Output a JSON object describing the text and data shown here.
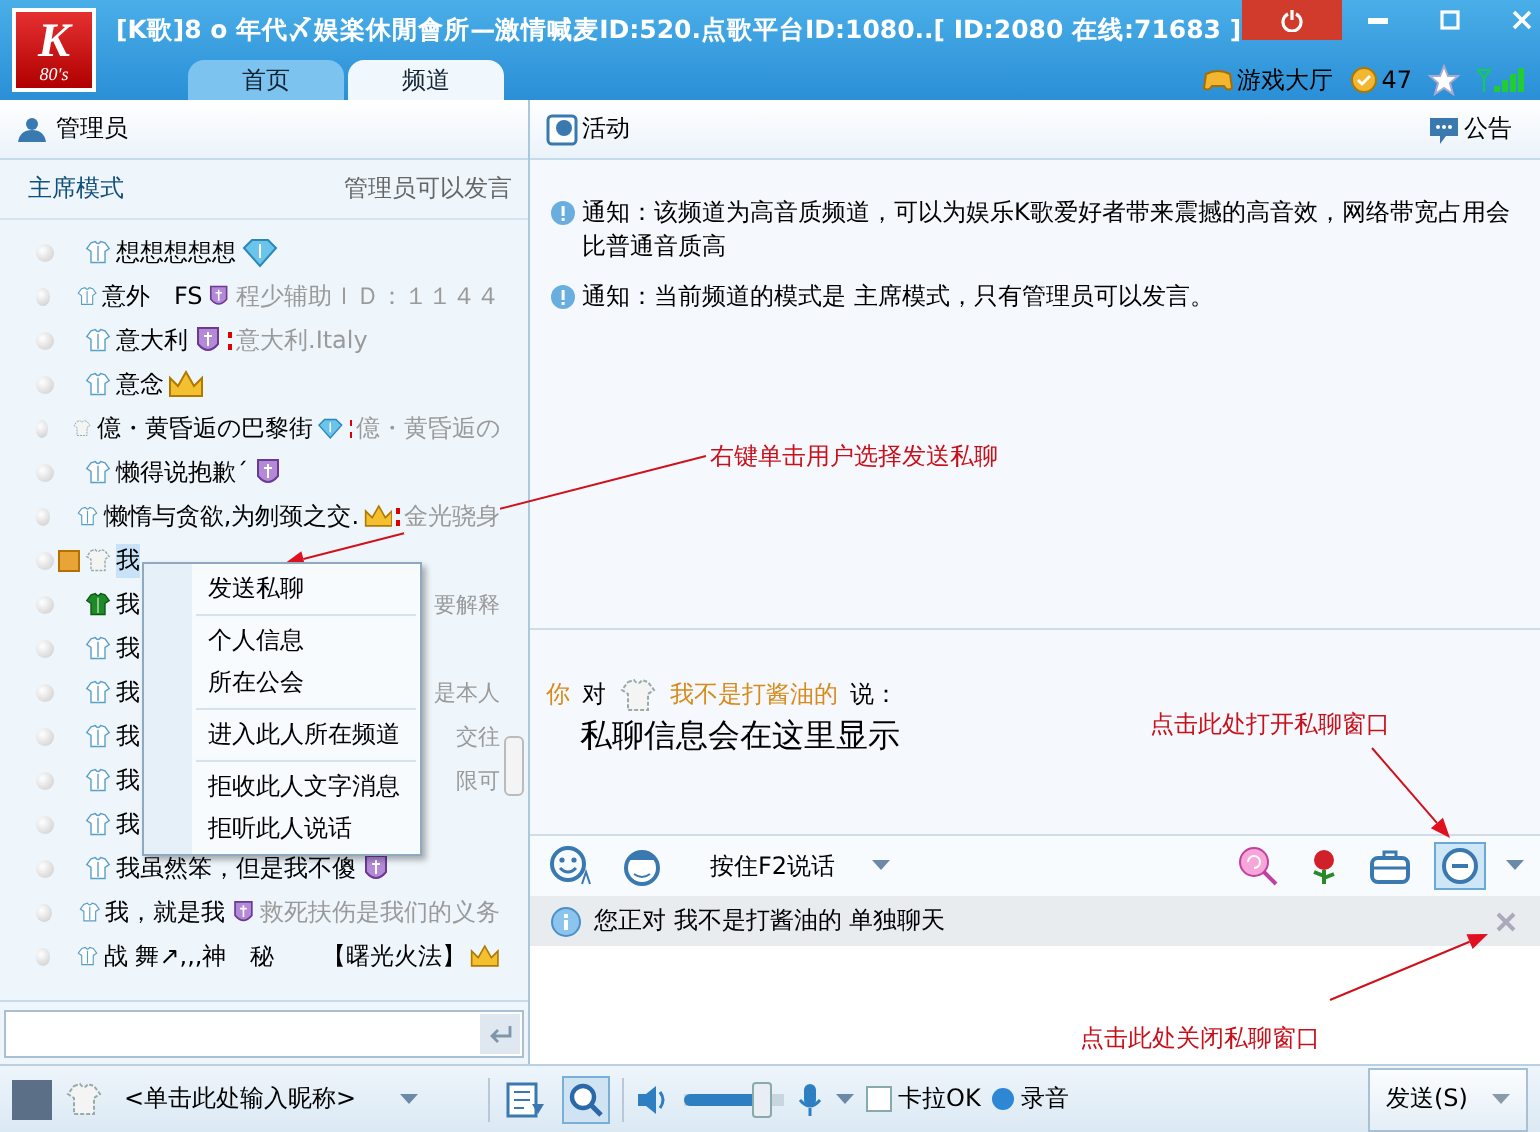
{
  "window": {
    "logo": "K",
    "logo_sub": "80's",
    "title": "[K歌]8 o 年代〆娱楽休閒會所—激情喊麦ID:520.点歌平台ID:1080..[ ID:2080 在线:71683 ]"
  },
  "tabs": [
    {
      "label": "首页",
      "selected": false
    },
    {
      "label": "频道",
      "selected": true
    }
  ],
  "top_right": {
    "game_hall": "游戏大厅",
    "coins": "47"
  },
  "left_panel": {
    "title": "管理员",
    "mode": "主席模式",
    "mode_note": "管理员可以发言",
    "users": [
      {
        "kind": "diamond",
        "name": "想想想想想",
        "guest": false,
        "admin": false,
        "flagged": false,
        "vip": false,
        "selected": false
      },
      {
        "kind": "shield",
        "name": "意外　FS",
        "guest": false,
        "admin": false,
        "flagged": false,
        "sign": "程少辅助ＩＤ：１１４４",
        "vip": false,
        "selected": false
      },
      {
        "kind": "shield",
        "name": "意大利",
        "guest": false,
        "admin": false,
        "flagged": true,
        "sign": "意大利.Italy",
        "vip": false,
        "selected": false
      },
      {
        "kind": "crown",
        "name": "意念",
        "guest": false,
        "admin": false,
        "flagged": false,
        "vip": false,
        "selected": false
      },
      {
        "kind": "diamond",
        "name": "億・黄昏逅の巴黎街",
        "guest": true,
        "admin": false,
        "flagged": true,
        "sign": "億・黄昏逅の",
        "vip": false,
        "selected": false
      },
      {
        "kind": "shield",
        "name": "懒得说抱歉ˊ",
        "guest": false,
        "admin": false,
        "flagged": false,
        "vip": false,
        "selected": false
      },
      {
        "kind": "crown",
        "name": "懒惰与贪欲,为刎颈之交.",
        "guest": false,
        "admin": false,
        "flagged": true,
        "sign": "金光骁身",
        "vip": false,
        "selected": false
      },
      {
        "kind": "plain",
        "name": "我",
        "guest": true,
        "admin": false,
        "flagged": false,
        "vip": true,
        "selected": true
      },
      {
        "kind": "plain",
        "name": "我",
        "guest": false,
        "admin": true,
        "flagged": false,
        "sign": "要解释",
        "vip": false,
        "selected": false
      },
      {
        "kind": "plain",
        "name": "我",
        "guest": false,
        "admin": false,
        "flagged": false,
        "vip": false,
        "selected": false
      },
      {
        "kind": "plain",
        "name": "我",
        "guest": false,
        "admin": false,
        "flagged": false,
        "sign": "是本人",
        "vip": false,
        "selected": false
      },
      {
        "kind": "plain",
        "name": "我",
        "guest": false,
        "admin": false,
        "flagged": false,
        "sign": "交往",
        "vip": false,
        "selected": false
      },
      {
        "kind": "plain",
        "name": "我",
        "guest": false,
        "admin": false,
        "flagged": false,
        "sign": "限可",
        "vip": false,
        "selected": false
      },
      {
        "kind": "plain",
        "name": "我",
        "guest": false,
        "admin": false,
        "flagged": false,
        "vip": false,
        "selected": false
      },
      {
        "kind": "shield",
        "name": "我虽然笨，但是我不傻",
        "guest": false,
        "admin": false,
        "flagged": false,
        "vip": false,
        "selected": false
      },
      {
        "kind": "shield",
        "name": "我，就是我",
        "guest": false,
        "admin": false,
        "flagged": false,
        "sign": "救死扶伤是我们的义务",
        "vip": false,
        "selected": false
      },
      {
        "kind": "crown",
        "name": "战 舞↗,,,神　秘　　【曙光火法】",
        "guest": false,
        "admin": false,
        "flagged": false,
        "vip": false,
        "selected": false
      }
    ]
  },
  "context_menu": {
    "groups": [
      [
        "发送私聊"
      ],
      [
        "个人信息",
        "所在公会"
      ],
      [
        "进入此人所在频道"
      ],
      [
        "拒收此人文字消息",
        "拒听此人说话"
      ]
    ]
  },
  "activity_panel": {
    "title": "活动",
    "notice_button": "公告",
    "messages": [
      "通知：该频道为高音质频道，可以为娱乐K歌爱好者带来震撼的高音效，网络带宽占用会比普通音质高",
      "通知：当前频道的模式是 主席模式，只有管理员可以发言。"
    ]
  },
  "private_chat": {
    "from": "你",
    "to_word": "对",
    "to": "我不是打酱油的",
    "says": "说：",
    "message": "私聊信息会在这里显示"
  },
  "chat_toolbar": {
    "talk_mode": "按住F2说话"
  },
  "info_bar": {
    "text": "您正对 我不是打酱油的 单独聊天"
  },
  "annotations": [
    "右键单击用户选择发送私聊",
    "点击此处打开私聊窗口",
    "点击此处关闭私聊窗口"
  ],
  "bottom_bar": {
    "nickname": "<单击此处输入昵称>",
    "volume": {
      "level": 0.78
    },
    "karaoke": {
      "label": "卡拉OK",
      "checked": false
    },
    "record": {
      "label": "录音"
    },
    "send": "发送(S)"
  }
}
